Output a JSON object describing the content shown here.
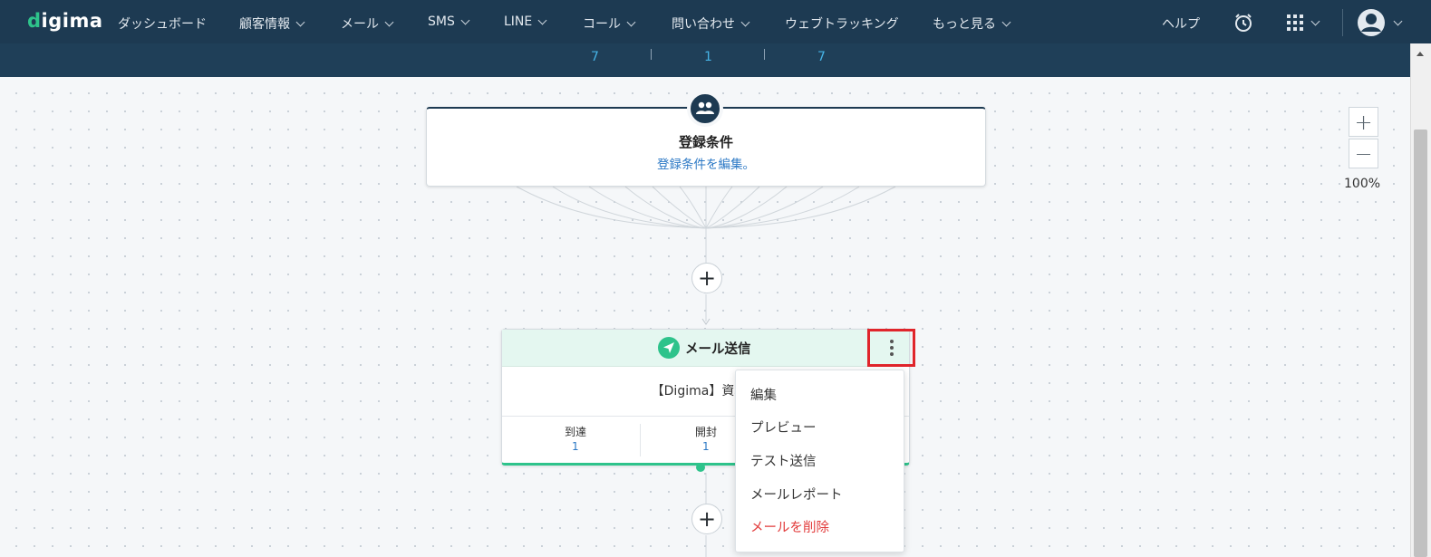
{
  "nav": {
    "logo": "digima",
    "items": [
      {
        "label": "ダッシュボード",
        "has_dropdown": false
      },
      {
        "label": "顧客情報",
        "has_dropdown": true
      },
      {
        "label": "メール",
        "has_dropdown": true
      },
      {
        "label": "SMS",
        "has_dropdown": true
      },
      {
        "label": "LINE",
        "has_dropdown": true
      },
      {
        "label": "コール",
        "has_dropdown": true
      },
      {
        "label": "問い合わせ",
        "has_dropdown": true
      },
      {
        "label": "ウェブトラッキング",
        "has_dropdown": false
      },
      {
        "label": "もっと見る",
        "has_dropdown": true
      }
    ],
    "help_label": "ヘルプ",
    "icons": [
      "alarm-clock-icon",
      "apps-grid-icon",
      "user-avatar-icon"
    ]
  },
  "stats_bar": {
    "values": [
      "7",
      "1",
      "7"
    ]
  },
  "zoom": {
    "plus": "+",
    "minus": "−",
    "level": "100%"
  },
  "condition_node": {
    "icon": "users-icon",
    "title": "登録条件",
    "link": "登録条件を編集。"
  },
  "add_buttons": [
    "+",
    "+"
  ],
  "mail_node": {
    "icon": "paper-plane-icon",
    "title": "メール送信",
    "subject": "【Digima】資料請",
    "stats": [
      {
        "label": "到達",
        "value": "1"
      },
      {
        "label": "開封",
        "value": "1"
      }
    ]
  },
  "context_menu": {
    "items": [
      {
        "label": "編集",
        "danger": false
      },
      {
        "label": "プレビュー",
        "danger": false
      },
      {
        "label": "テスト送信",
        "danger": false
      },
      {
        "label": "メールレポート",
        "danger": false
      },
      {
        "label": "メールを削除",
        "danger": true
      }
    ]
  },
  "colors": {
    "header_bg": "#1d3a52",
    "accent_green": "#2ec38b",
    "link_blue": "#2b78c5",
    "danger_red": "#e23c3c",
    "highlight_red": "#e0252b"
  }
}
